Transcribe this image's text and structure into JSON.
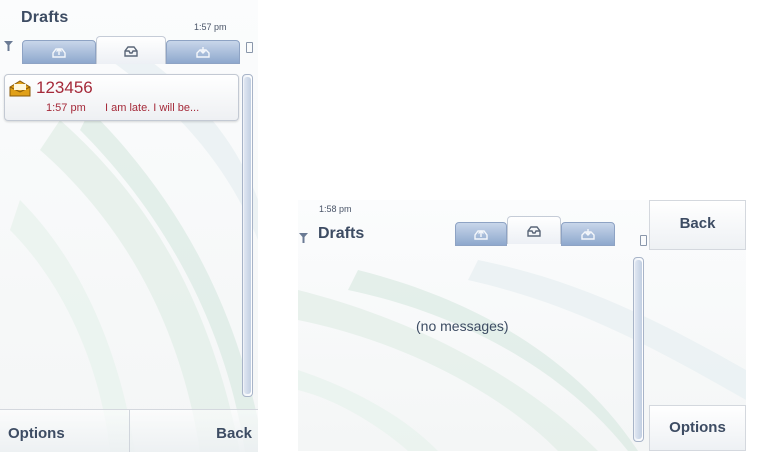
{
  "portrait": {
    "title": "Drafts",
    "clock": "1:57 pm",
    "filter_icon": "filter-icon",
    "tabs": [
      {
        "icon": "upload-icon",
        "active": false
      },
      {
        "icon": "outbox-icon",
        "active": true
      },
      {
        "icon": "tray-icon",
        "active": false
      }
    ],
    "message": {
      "sender": "123456",
      "time": "1:57 pm",
      "preview": "I am late. I will be...",
      "icon": "envelope-icon"
    },
    "softkeys": {
      "left": "Options",
      "right": "Back"
    }
  },
  "landscape": {
    "clock": "1:58 pm",
    "title": "Drafts",
    "empty_text": "(no messages)",
    "softkeys": {
      "top": "Back",
      "bottom": "Options"
    }
  },
  "colors": {
    "title_text": "#3d4c63",
    "message_text": "#a52a3a",
    "tab_inactive": "#8ea8cd",
    "tab_active": "#ffffff"
  }
}
